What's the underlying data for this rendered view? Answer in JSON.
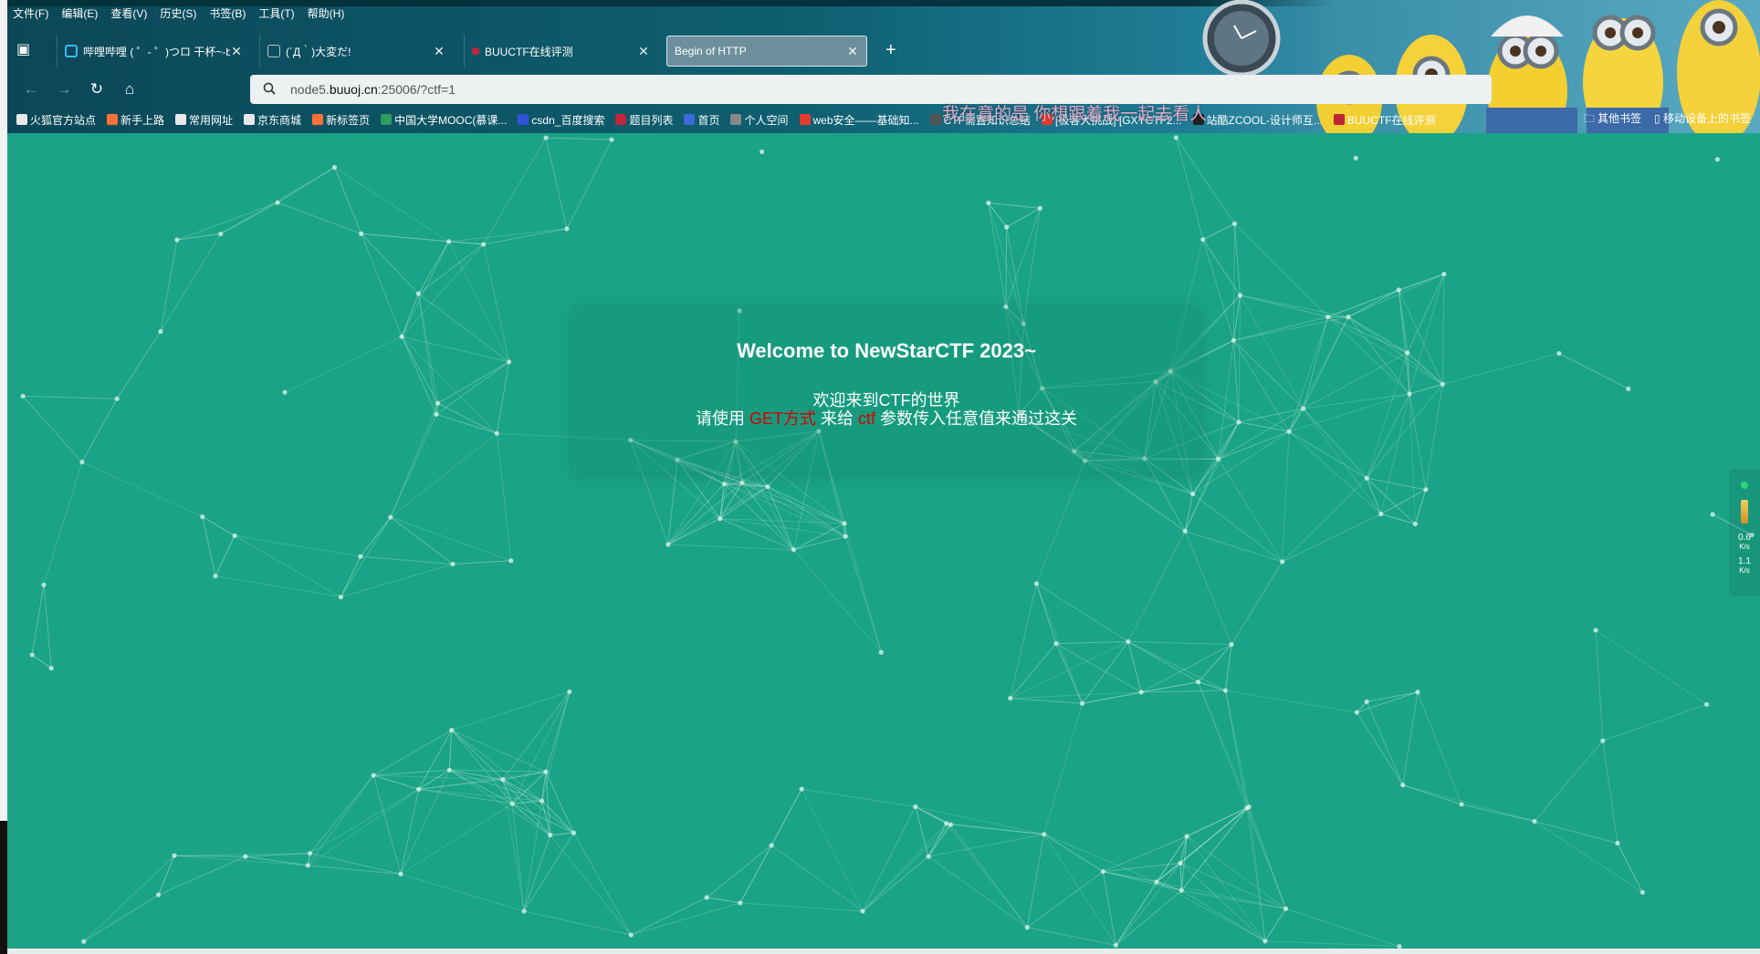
{
  "menubar": [
    "文件(F)",
    "编辑(E)",
    "查看(V)",
    "历史(S)",
    "书签(B)",
    "工具(T)",
    "帮助(H)"
  ],
  "tabs": [
    {
      "title": "哔哩哔哩 ( ゜- ゜)つロ 干杯~-bi",
      "favicon_color": "#3db8f5",
      "active": false
    },
    {
      "title": "(´Д｀)大変だ!",
      "favicon_color": "#8aa0a8",
      "active": false
    },
    {
      "title": "BUUCTF在线评测",
      "favicon_color": "#c0253a",
      "active": false
    },
    {
      "title": "Begin of HTTP",
      "favicon_color": "",
      "active": true
    }
  ],
  "urlbar": {
    "host_prefix": "node5.",
    "host_domain": "buuoj.cn",
    "rest": ":25006/?ctf=1"
  },
  "bookmarks": [
    {
      "label": "火狐官方站点",
      "icon_color": "#e8e8e8"
    },
    {
      "label": "新手上路",
      "icon_color": "#ff7139"
    },
    {
      "label": "常用网址",
      "icon_color": "#e8e8e8"
    },
    {
      "label": "京东商城",
      "icon_color": "#e8e8e8"
    },
    {
      "label": "新标签页",
      "icon_color": "#ff7139"
    },
    {
      "label": "中国大学MOOC(慕课...",
      "icon_color": "#2e9c5a"
    },
    {
      "label": "csdn_百度搜索",
      "icon_color": "#3053d6"
    },
    {
      "label": "题目列表",
      "icon_color": "#c0253a"
    },
    {
      "label": "首页",
      "icon_color": "#3d6bd8"
    },
    {
      "label": "个人空间",
      "icon_color": "#888888"
    },
    {
      "label": "web安全——基础知...",
      "icon_color": "#e33b2e"
    },
    {
      "label": "CTF需置知识总结",
      "icon_color": "#555555"
    },
    {
      "label": "[极客大挑战] [GXYCTF2...",
      "icon_color": "#e33b2e"
    },
    {
      "label": "站酷ZCOOL-设计师互...",
      "icon_color": "#222222"
    },
    {
      "label": "BUUCTF在线评测",
      "icon_color": "#c0253a"
    }
  ],
  "bookmarks_right": [
    "其他书签",
    "移动设备上的书签"
  ],
  "overlay_text": "我在意的是 你想跟着我一起去看人",
  "card": {
    "title": "Welcome to NewStarCTF 2023~",
    "line1": "欢迎来到CTF的世界",
    "line2_a": "请使用 ",
    "line2_b": "GET方式",
    "line2_c": " 来给 ",
    "line2_d": "ctf",
    "line2_e": " 参数传入任意值来通过这关"
  },
  "sidewidget": {
    "up": "0.6",
    "up_unit": "K/s",
    "down": "1.1",
    "down_unit": "K/s"
  },
  "colors": {
    "page_bg": "#1aa386",
    "accent_red": "#d60000",
    "chrome": "#0e5f70"
  }
}
